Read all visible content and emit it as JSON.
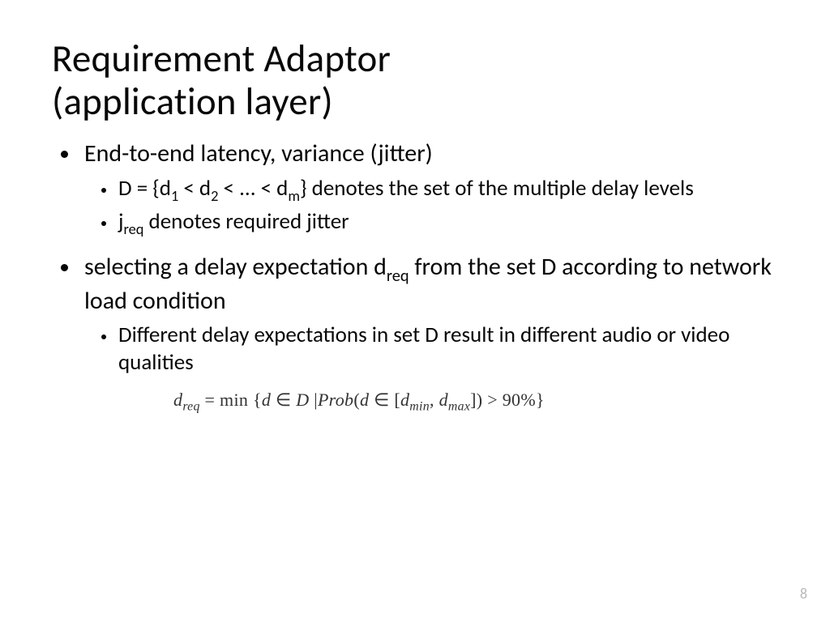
{
  "title_line1": "Requirement Adaptor",
  "title_line2": "(application layer)",
  "bullets": {
    "b1": "End-to-end latency, variance (jitter)",
    "b1a_pre": "D = {d",
    "b1a_s1": "1",
    "b1a_mid1": " < d",
    "b1a_s2": "2",
    "b1a_mid2": " < ... < d",
    "b1a_s3": "m",
    "b1a_post": "} denotes the set of the multiple delay levels",
    "b1b_pre": "j",
    "b1b_sub": "req",
    "b1b_post": " denotes required jitter",
    "b2_pre": "selecting a delay expectation d",
    "b2_sub": "req",
    "b2_post": " from the set D according to network load condition",
    "b2a": "Different delay expectations in set D result in different audio or video qualities"
  },
  "equation": {
    "p1": "d",
    "p1s": "req",
    "eq": " = ",
    "min": "min",
    "brace_open": " {",
    "d1": "d ",
    "in1": " ∈ ",
    "D": " D ",
    "bar": " |",
    "prob": "Prob",
    "paren_open": "(",
    "d2": "d ",
    "in2": " ∈ ",
    "brack_open": "[",
    "dmin": "d",
    "dmin_s": "min",
    "comma": ",  ",
    "dmax": "d",
    "dmax_s": "max",
    "brack_close": "]",
    "paren_close": ")",
    "gt": " > ",
    "pct": "90%",
    "brace_close": "}"
  },
  "page_number": "8"
}
